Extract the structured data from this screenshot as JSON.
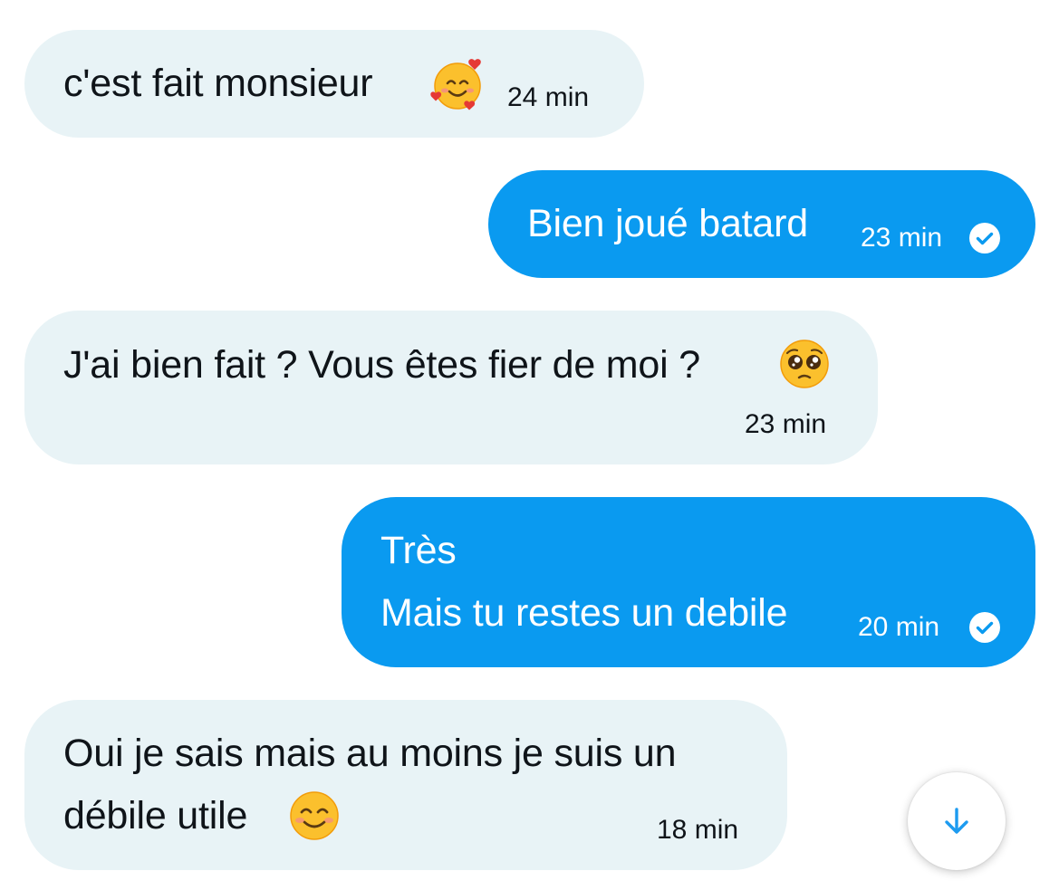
{
  "messages": [
    {
      "direction": "incoming",
      "text": "c'est fait monsieur",
      "emoji": "smiling-face-with-hearts",
      "time": "24 min"
    },
    {
      "direction": "outgoing",
      "text": "Bien joué batard",
      "time": "23 min",
      "status": "read"
    },
    {
      "direction": "incoming",
      "text": "J'ai bien fait ? Vous êtes fier de moi ?",
      "emoji": "pleading-face",
      "time": "23 min"
    },
    {
      "direction": "outgoing",
      "line1": "Très",
      "line2": "Mais tu restes un debile",
      "time": "20 min",
      "status": "read"
    },
    {
      "direction": "incoming",
      "line1": "Oui je sais mais au moins je suis un",
      "line2": "débile utile",
      "emoji": "smiling-face-with-smiling-eyes",
      "time": "18 min"
    }
  ],
  "scroll_button": {
    "icon": "arrow-down-icon"
  },
  "colors": {
    "incoming_bubble": "#e8f3f6",
    "outgoing_bubble": "#0a9af0",
    "text": "#0f1419",
    "accent": "#1d9bf0"
  }
}
